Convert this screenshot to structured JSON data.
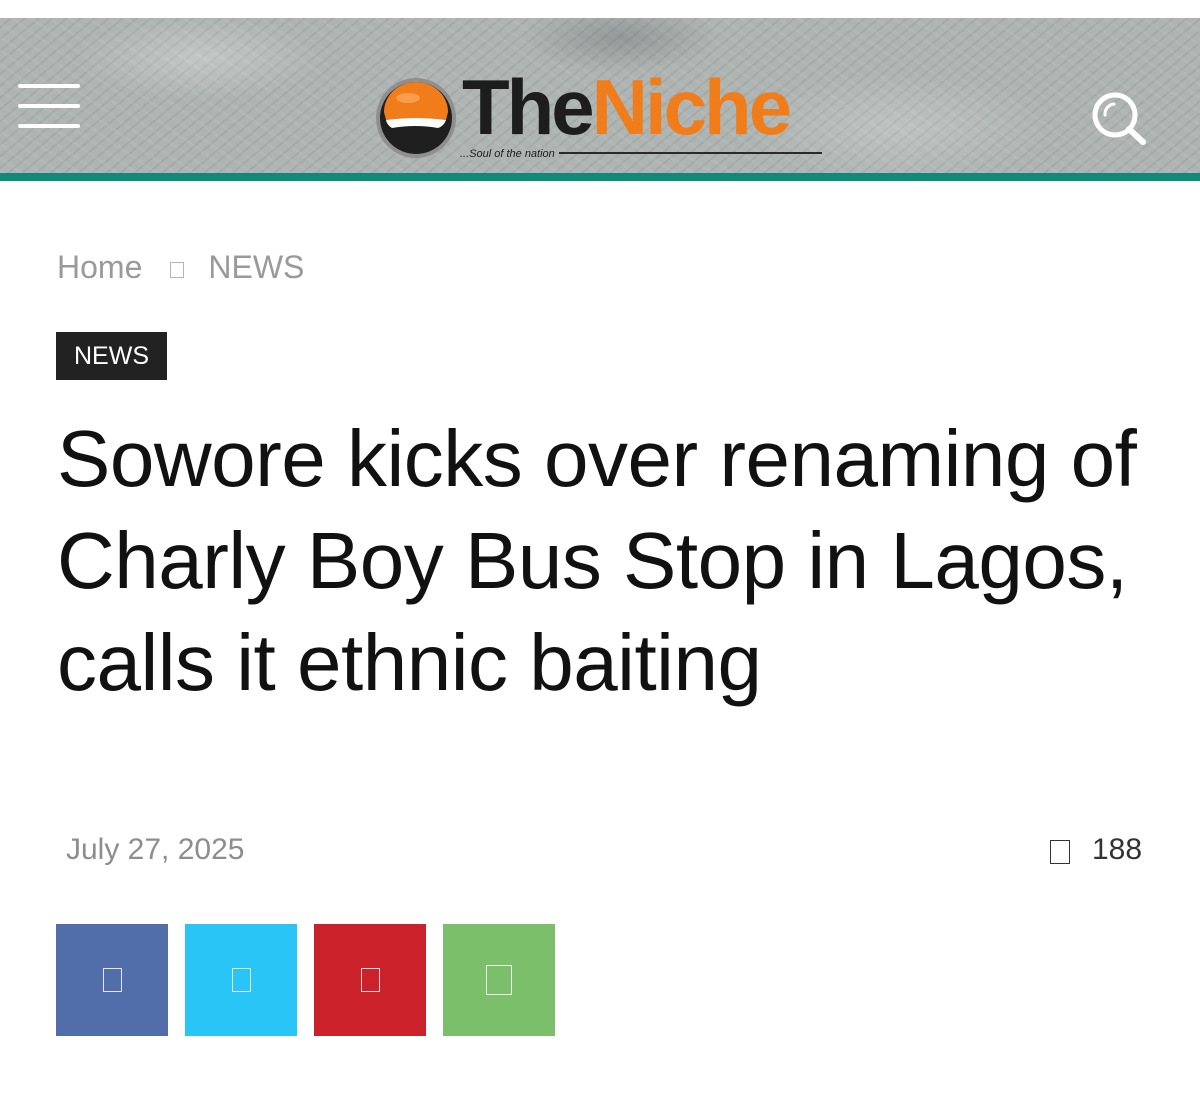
{
  "header": {
    "logo": {
      "word_the": "The",
      "word_niche": "Niche",
      "tagline": "...Soul of the nation"
    },
    "menu_icon": "hamburger-menu-icon",
    "search_icon": "search-icon",
    "accent_color": "#0f8a79",
    "brand_orange": "#f07d1a"
  },
  "breadcrumb": {
    "items": [
      "Home",
      "NEWS"
    ],
    "separator_icon": "chevron-right-icon"
  },
  "article": {
    "category": "NEWS",
    "title": "Sowore kicks over renaming  of Charly Boy Bus Stop in Lagos, calls it ethnic baiting",
    "date": "July 27, 2025",
    "views": "188",
    "views_icon": "eye-icon"
  },
  "share": [
    {
      "network": "facebook",
      "icon": "facebook-icon",
      "color": "#516eab"
    },
    {
      "network": "twitter",
      "icon": "twitter-icon",
      "color": "#29c5f6"
    },
    {
      "network": "pinterest",
      "icon": "pinterest-icon",
      "color": "#ca212a"
    },
    {
      "network": "whatsapp",
      "icon": "whatsapp-icon",
      "color": "#7bbf6a"
    }
  ]
}
